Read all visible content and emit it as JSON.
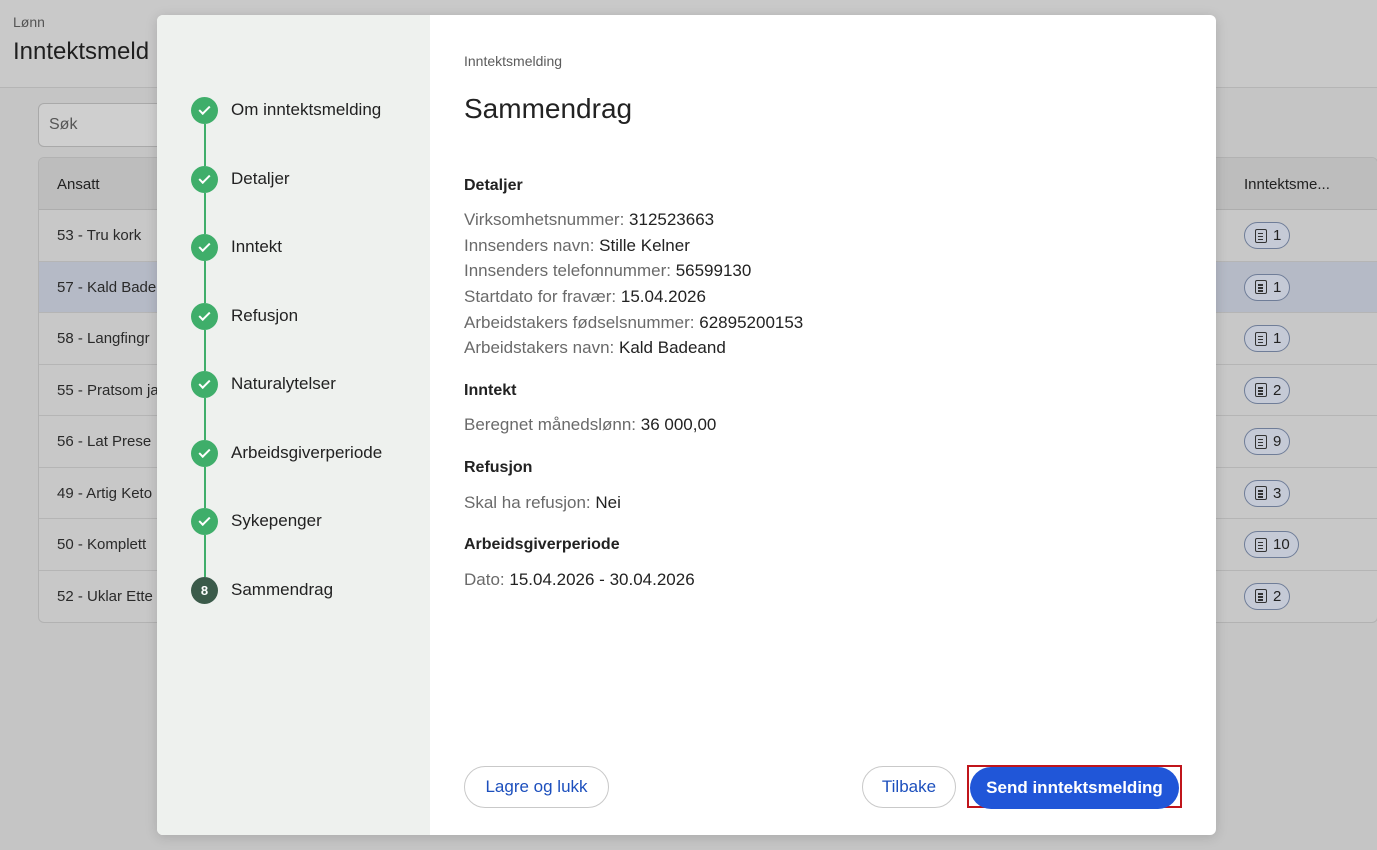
{
  "background": {
    "breadcrumb": "Lønn",
    "title": "Inntektsmeld",
    "search_placeholder": "Søk",
    "table": {
      "col_left": "Ansatt",
      "col_right": "Inntektsme...",
      "rows": [
        {
          "name": "53 - Tru kork",
          "count": "1"
        },
        {
          "name": "57 - Kald Bade",
          "count": "1"
        },
        {
          "name": "58 - Langfingr",
          "count": "1"
        },
        {
          "name": "55 - Pratsom ja",
          "count": "2"
        },
        {
          "name": "56 - Lat Prese",
          "count": "9"
        },
        {
          "name": "49 - Artig Keto",
          "count": "3"
        },
        {
          "name": "50 - Komplett",
          "count": "10"
        },
        {
          "name": "52 - Uklar Ette",
          "count": "2"
        }
      ]
    }
  },
  "stepper": {
    "steps": [
      {
        "label": "Om inntektsmelding",
        "state": "done"
      },
      {
        "label": "Detaljer",
        "state": "done"
      },
      {
        "label": "Inntekt",
        "state": "done"
      },
      {
        "label": "Refusjon",
        "state": "done"
      },
      {
        "label": "Naturalytelser",
        "state": "done"
      },
      {
        "label": "Arbeidsgiverperiode",
        "state": "done"
      },
      {
        "label": "Sykepenger",
        "state": "done"
      },
      {
        "label": "Sammendrag",
        "state": "current",
        "number": "8"
      }
    ]
  },
  "summary": {
    "breadcrumb": "Inntektsmelding",
    "title": "Sammendrag",
    "detaljer": {
      "title": "Detaljer",
      "orgnr_label": "Virksomhetsnummer:",
      "orgnr": "312523663",
      "sender_label": "Innsenders navn:",
      "sender": "Stille Kelner",
      "phone_label": "Innsenders telefonnummer:",
      "phone": "56599130",
      "start_label": "Startdato for fravær:",
      "start": "15.04.2026",
      "fnr_label": "Arbeidstakers fødselsnummer:",
      "fnr": "62895200153",
      "name_label": "Arbeidstakers navn:",
      "name": "Kald Badeand"
    },
    "inntekt": {
      "title": "Inntekt",
      "salary_label": "Beregnet månedslønn:",
      "salary": "36 000,00"
    },
    "refusjon": {
      "title": "Refusjon",
      "refund_label": "Skal ha refusjon:",
      "refund": "Nei"
    },
    "agp": {
      "title": "Arbeidsgiverperiode",
      "date_label": "Dato:",
      "date": "15.04.2026 - 30.04.2026"
    }
  },
  "footer": {
    "save_close": "Lagre og lukk",
    "back": "Tilbake",
    "send": "Send inntektsmelding"
  }
}
